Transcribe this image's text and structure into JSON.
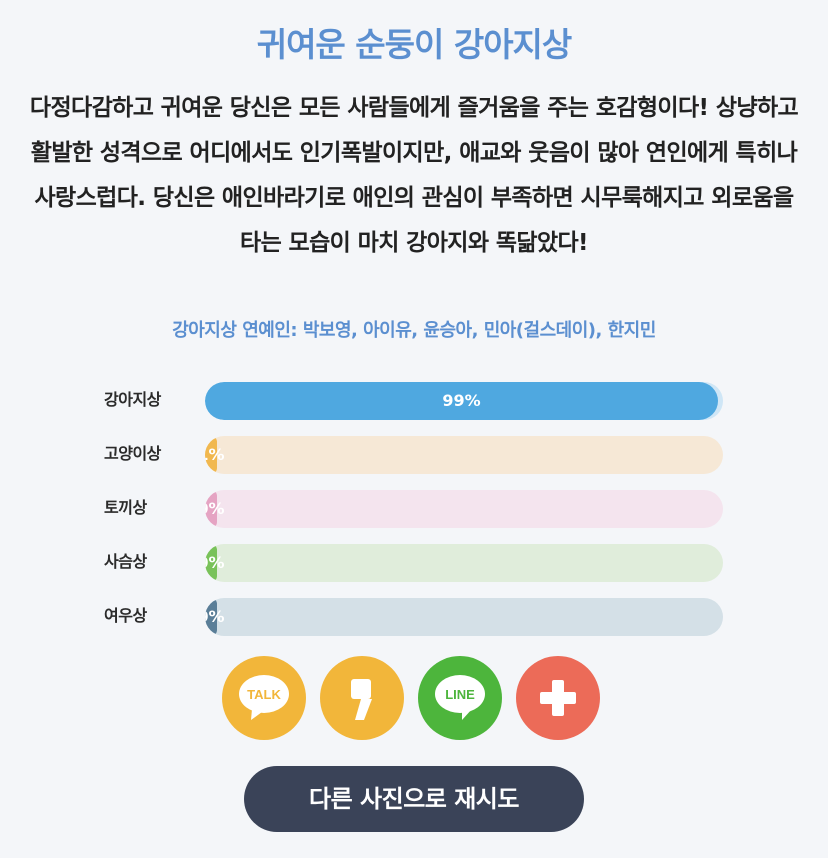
{
  "result": {
    "title": "귀여운 순둥이 강아지상",
    "description": "다정다감하고 귀여운 당신은 모든 사람들에게 즐거움을 주는 호감형이다! 상냥하고 활발한 성격으로 어디에서도 인기폭발이지만, 애교와 웃음이 많아 연인에게 특히나 사랑스럽다. 당신은 애인바라기로 애인의 관심이 부족하면 시무룩해지고 외로움을 타는 모습이 마치 강아지와 똑닮았다!",
    "celebrities": "강아지상 연예인: 박보영, 아이유, 윤승아, 민아(걸스데이), 한지민"
  },
  "bars": [
    {
      "label": "강아지상",
      "percent_text": "99%",
      "value": 99,
      "color": "#4fa8e0",
      "track_color": "#cfe6f6"
    },
    {
      "label": "고양이상",
      "percent_text": "1%",
      "value": 1,
      "color": "#f1b84f",
      "track_color": "#f6e8d6"
    },
    {
      "label": "토끼상",
      "percent_text": "0%",
      "value": 0,
      "color": "#e5a4c3",
      "track_color": "#f4e4ee"
    },
    {
      "label": "사슴상",
      "percent_text": "0%",
      "value": 0,
      "color": "#79c25a",
      "track_color": "#e0eddb"
    },
    {
      "label": "여우상",
      "percent_text": "0%",
      "value": 0,
      "color": "#5a7e98",
      "track_color": "#d4e0e7"
    }
  ],
  "share": {
    "kakaotalk": {
      "icon": "kakaotalk-icon",
      "text": "TALK",
      "color": "#f2b63a"
    },
    "kakaostory": {
      "icon": "kakaostory-icon",
      "color": "#f2b63a"
    },
    "line": {
      "icon": "line-icon",
      "text": "LINE",
      "color": "#4db53c"
    },
    "more": {
      "icon": "plus-icon",
      "color": "#ec6b58"
    }
  },
  "retry_button": "다른 사진으로 재시도"
}
